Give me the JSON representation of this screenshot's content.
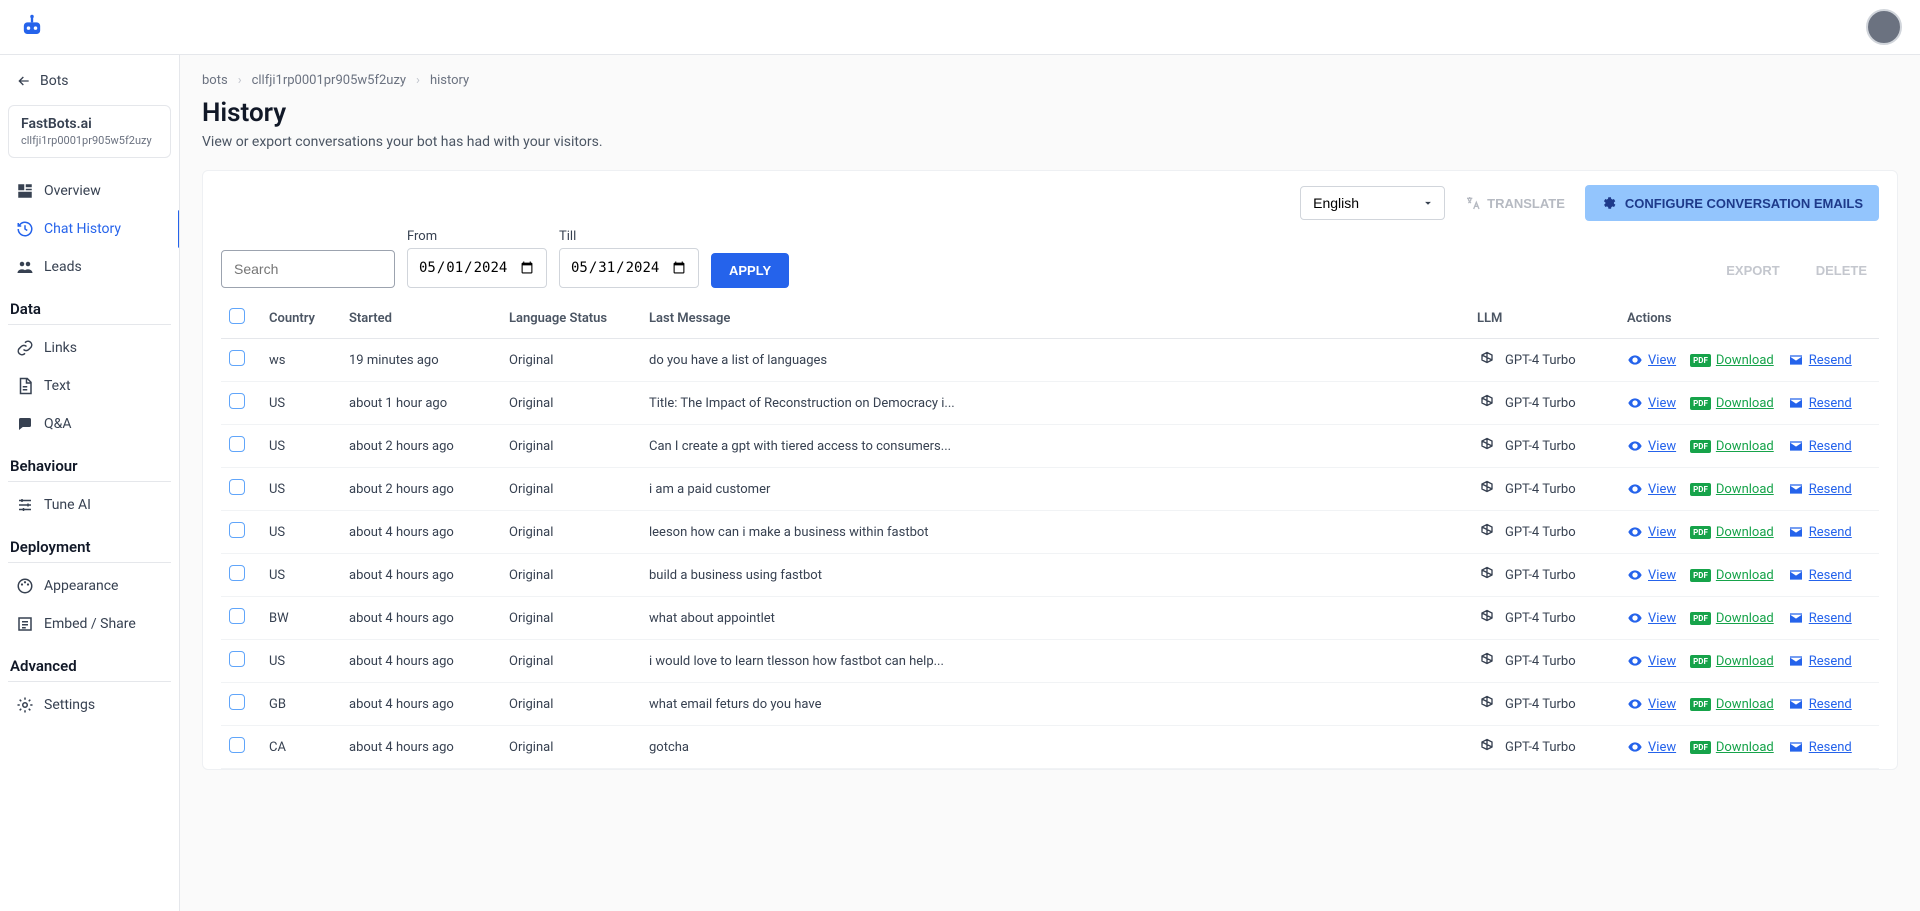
{
  "header": {
    "avatar_alt": "User avatar"
  },
  "sidebar": {
    "back_label": "Bots",
    "bot": {
      "name": "FastBots.ai",
      "id": "cllfji1rp0001pr905w5f2uzy"
    },
    "nav_top": [
      {
        "label": "Overview",
        "icon": "overview"
      },
      {
        "label": "Chat History",
        "icon": "history",
        "active": true
      },
      {
        "label": "Leads",
        "icon": "leads"
      }
    ],
    "sections": [
      {
        "title": "Data",
        "items": [
          {
            "label": "Links",
            "icon": "link"
          },
          {
            "label": "Text",
            "icon": "text"
          },
          {
            "label": "Q&A",
            "icon": "qa"
          }
        ]
      },
      {
        "title": "Behaviour",
        "items": [
          {
            "label": "Tune AI",
            "icon": "tune"
          }
        ]
      },
      {
        "title": "Deployment",
        "items": [
          {
            "label": "Appearance",
            "icon": "appearance"
          },
          {
            "label": "Embed / Share",
            "icon": "embed"
          }
        ]
      },
      {
        "title": "Advanced",
        "items": [
          {
            "label": "Settings",
            "icon": "settings"
          }
        ]
      }
    ]
  },
  "breadcrumb": [
    "bots",
    "cllfji1rp0001pr905w5f2uzy",
    "history"
  ],
  "page": {
    "title": "History",
    "subtitle": "View or export conversations your bot has had with your visitors."
  },
  "toolbar": {
    "language_value": "English",
    "translate_label": "TRANSLATE",
    "configure_label": "CONFIGURE CONVERSATION EMAILS"
  },
  "filters": {
    "search_placeholder": "Search",
    "from_label": "From",
    "from_value": "2024-05-01",
    "till_label": "Till",
    "till_value": "2024-05-31",
    "apply_label": "APPLY",
    "export_label": "EXPORT",
    "delete_label": "DELETE"
  },
  "table": {
    "headers": {
      "country": "Country",
      "started": "Started",
      "language": "Language Status",
      "last": "Last Message",
      "llm": "LLM",
      "actions": "Actions"
    },
    "action_labels": {
      "view": "View",
      "download": "Download",
      "resend": "Resend",
      "pdf": "PDF"
    },
    "rows": [
      {
        "country": "ws",
        "started": "19 minutes ago",
        "lang": "Original",
        "last": "do you have a list of languages",
        "llm": "GPT-4 Turbo"
      },
      {
        "country": "US",
        "started": "about 1 hour ago",
        "lang": "Original",
        "last": "Title: The Impact of Reconstruction on Democracy i...",
        "llm": "GPT-4 Turbo"
      },
      {
        "country": "US",
        "started": "about 2 hours ago",
        "lang": "Original",
        "last": "Can I create a gpt with tiered access to consumers...",
        "llm": "GPT-4 Turbo"
      },
      {
        "country": "US",
        "started": "about 2 hours ago",
        "lang": "Original",
        "last": "i am a paid customer",
        "llm": "GPT-4 Turbo"
      },
      {
        "country": "US",
        "started": "about 4 hours ago",
        "lang": "Original",
        "last": "leeson how can i make a business within fastbot",
        "llm": "GPT-4 Turbo"
      },
      {
        "country": "US",
        "started": "about 4 hours ago",
        "lang": "Original",
        "last": "build a business using fastbot",
        "llm": "GPT-4 Turbo"
      },
      {
        "country": "BW",
        "started": "about 4 hours ago",
        "lang": "Original",
        "last": "what about appointlet",
        "llm": "GPT-4 Turbo"
      },
      {
        "country": "US",
        "started": "about 4 hours ago",
        "lang": "Original",
        "last": "i would love to learn tlesson how fastbot can help...",
        "llm": "GPT-4 Turbo"
      },
      {
        "country": "GB",
        "started": "about 4 hours ago",
        "lang": "Original",
        "last": "what email feturs do you have",
        "llm": "GPT-4 Turbo"
      },
      {
        "country": "CA",
        "started": "about 4 hours ago",
        "lang": "Original",
        "last": "gotcha",
        "llm": "GPT-4 Turbo"
      }
    ]
  }
}
